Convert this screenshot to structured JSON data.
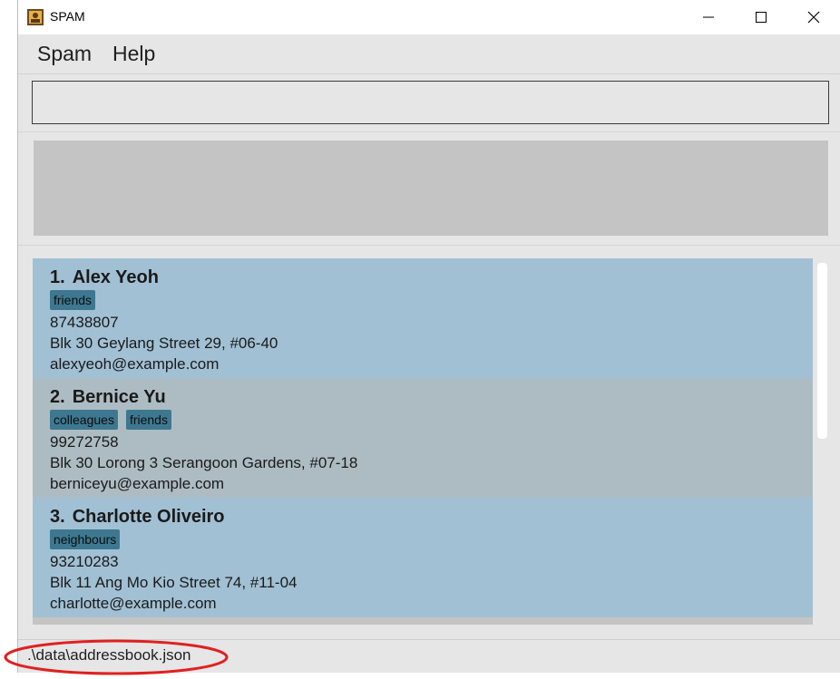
{
  "window": {
    "title": "SPAM",
    "minimize_icon": "minimize-icon",
    "maximize_icon": "maximize-icon",
    "close_icon": "close-icon"
  },
  "menu": {
    "items": [
      {
        "label": "Spam"
      },
      {
        "label": "Help"
      }
    ]
  },
  "command_box": {
    "value": ""
  },
  "result_display": {
    "text": ""
  },
  "persons": [
    {
      "index": "1.",
      "name": "Alex Yeoh",
      "tags": [
        "friends"
      ],
      "phone": "87438807",
      "address": "Blk 30 Geylang Street 29, #06-40",
      "email": "alexyeoh@example.com"
    },
    {
      "index": "2.",
      "name": "Bernice Yu",
      "tags": [
        "colleagues",
        "friends"
      ],
      "phone": "99272758",
      "address": "Blk 30 Lorong 3 Serangoon Gardens, #07-18",
      "email": "berniceyu@example.com"
    },
    {
      "index": "3.",
      "name": "Charlotte Oliveiro",
      "tags": [
        "neighbours"
      ],
      "phone": "93210283",
      "address": "Blk 11 Ang Mo Kio Street 74, #11-04",
      "email": "charlotte@example.com"
    }
  ],
  "status_bar": {
    "file_path": ".\\data\\addressbook.json"
  },
  "colors": {
    "card_odd": "#a1c0d4",
    "card_even": "#adbcc3",
    "tag": "#3d7890",
    "annotation": "#e02020"
  }
}
